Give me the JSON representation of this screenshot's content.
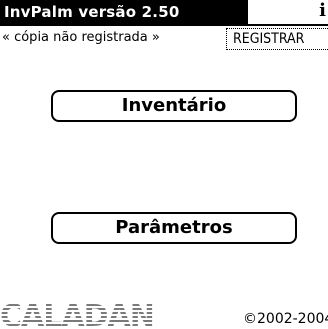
{
  "header": {
    "title": "InvPalm versão 2.50",
    "info_icon": "i"
  },
  "registration": {
    "status": "« cópia não registrada »",
    "register_label": "REGISTRAR"
  },
  "menu": {
    "inventory_label": "Inventário",
    "parameters_label": "Parâmetros"
  },
  "footer": {
    "logo_text": "CALADAN",
    "copyright": "©2002-2004"
  }
}
